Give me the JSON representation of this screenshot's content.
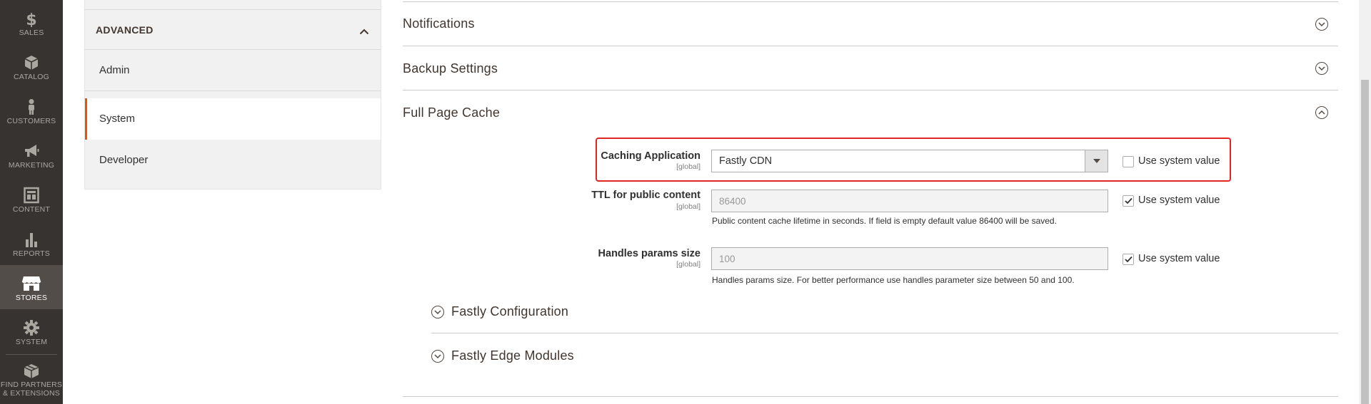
{
  "nav": {
    "items": [
      {
        "label": "SALES",
        "icon": "dollar-icon"
      },
      {
        "label": "CATALOG",
        "icon": "cube-icon"
      },
      {
        "label": "CUSTOMERS",
        "icon": "person-icon"
      },
      {
        "label": "MARKETING",
        "icon": "megaphone-icon"
      },
      {
        "label": "CONTENT",
        "icon": "layout-icon"
      },
      {
        "label": "REPORTS",
        "icon": "bar-chart-icon"
      },
      {
        "label": "STORES",
        "icon": "storefront-icon"
      },
      {
        "label": "SYSTEM",
        "icon": "gear-icon"
      },
      {
        "label_line1": "FIND PARTNERS",
        "label_line2": "& EXTENSIONS",
        "icon": "box-icon"
      }
    ],
    "active": "STORES"
  },
  "tabs": {
    "group_title": "ADVANCED",
    "links": [
      {
        "label": "Admin"
      },
      {
        "label": "System"
      },
      {
        "label": "Developer"
      }
    ],
    "active": "System"
  },
  "sections": {
    "notifications": "Notifications",
    "backup": "Backup Settings",
    "full_page_cache": "Full Page Cache"
  },
  "fpc": {
    "caching_application": {
      "label": "Caching Application",
      "scope": "[global]",
      "value": "Fastly CDN",
      "use_system_value": "Use system value",
      "use_system_checked": false
    },
    "ttl": {
      "label": "TTL for public content",
      "scope": "[global]",
      "value": "86400",
      "note": "Public content cache lifetime in seconds. If field is empty default value 86400 will be saved.",
      "use_system_value": "Use system value",
      "use_system_checked": true
    },
    "handles": {
      "label": "Handles params size",
      "scope": "[global]",
      "value": "100",
      "note": "Handles params size. For better performance use handles parameter size between 50 and 100.",
      "use_system_value": "Use system value",
      "use_system_checked": true
    }
  },
  "subsections": {
    "fastly_configuration": "Fastly Configuration",
    "fastly_edge_modules": "Fastly Edge Modules"
  },
  "colors": {
    "nav_bg": "#373330",
    "nav_active": "#524d49",
    "accent": "#eb5202",
    "highlight": "#e22626"
  }
}
